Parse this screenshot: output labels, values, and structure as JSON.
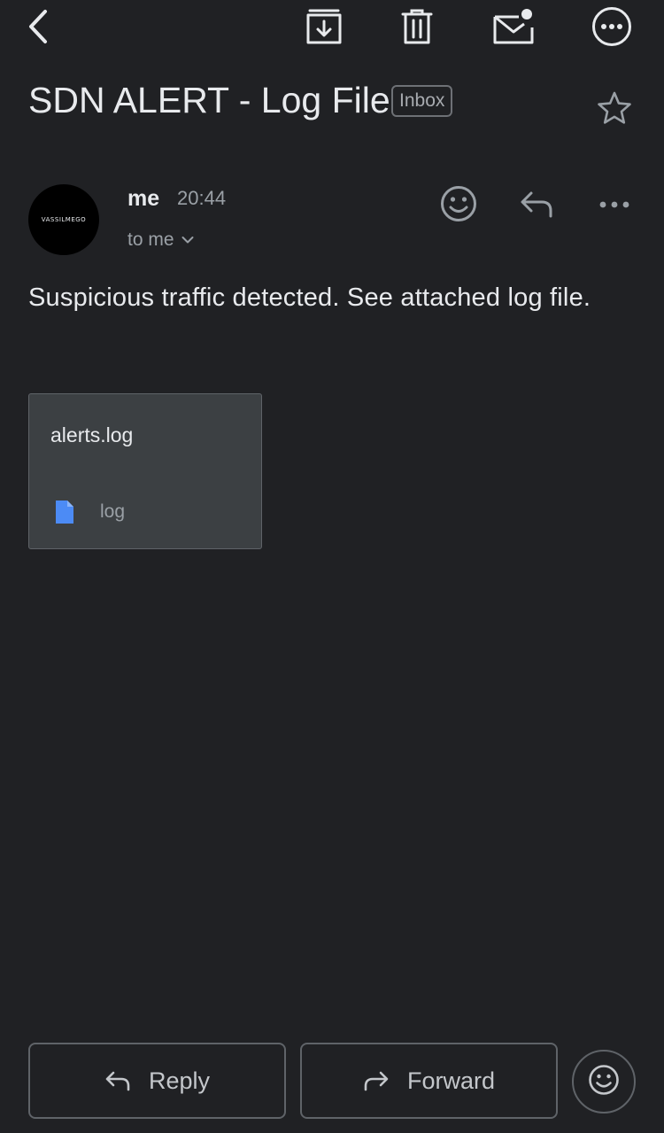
{
  "toolbar": {
    "icons": [
      "back-icon",
      "archive-icon",
      "delete-icon",
      "mark-unread-icon",
      "more-options-icon"
    ]
  },
  "subject": {
    "title": "SDN ALERT - Log File",
    "label": "Inbox"
  },
  "message": {
    "avatar_text": "VASSILMEGO",
    "sender": "me",
    "time": "20:44",
    "recipient": "to me",
    "body": "Suspicious traffic detected. See attached log file."
  },
  "attachment": {
    "name": "alerts.log",
    "type": "log",
    "icon": "file-icon",
    "icon_color": "#4c8bf5"
  },
  "actions": {
    "reply_label": "Reply",
    "forward_label": "Forward"
  },
  "colors": {
    "background": "#202124",
    "text": "#e8eaed",
    "secondary_text": "#9aa0a6",
    "card": "#3c4043"
  }
}
